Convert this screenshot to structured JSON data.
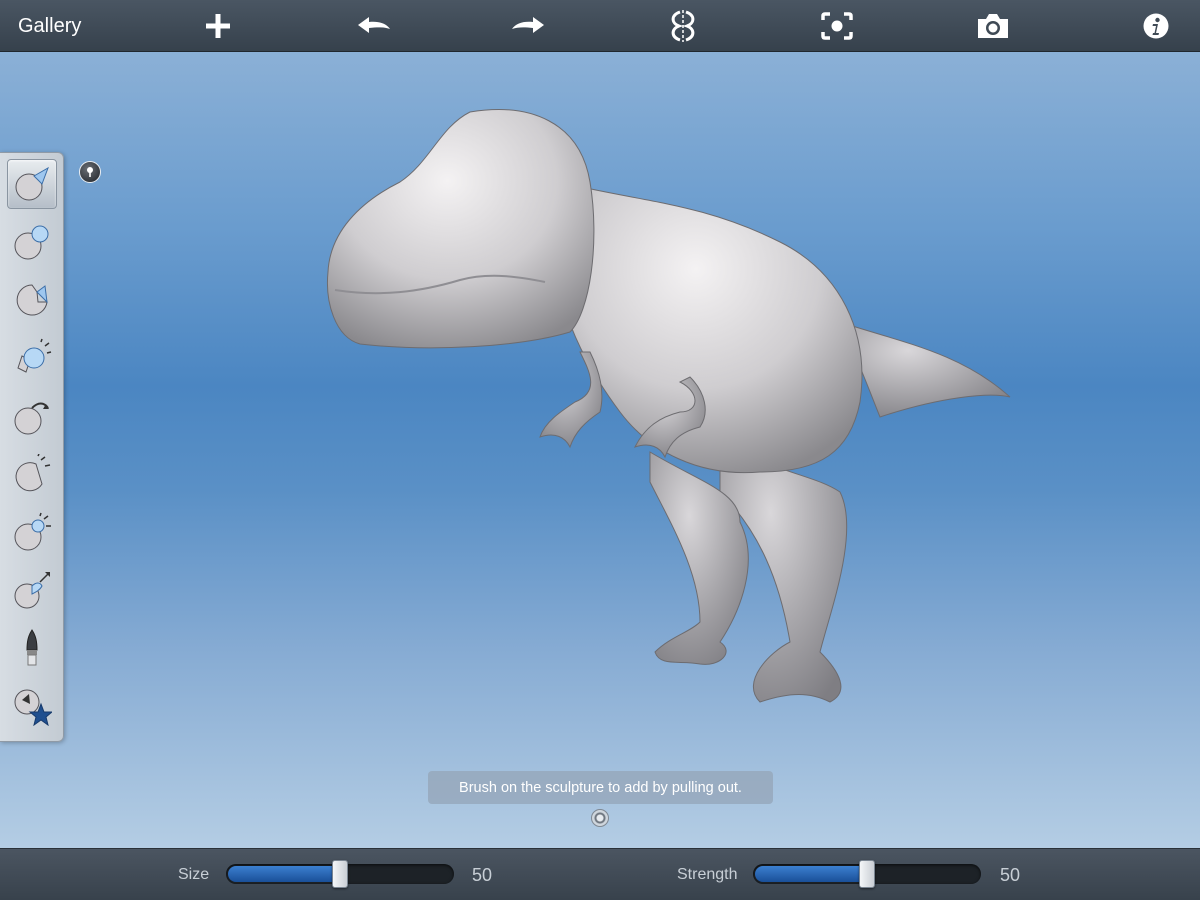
{
  "topbar": {
    "gallery_label": "Gallery",
    "icons": [
      "plus-icon",
      "undo-icon",
      "redo-icon",
      "symmetry-icon",
      "frame-icon",
      "camera-icon",
      "info-icon"
    ]
  },
  "tools": [
    {
      "name": "draw-tool",
      "active": true
    },
    {
      "name": "inflate-tool",
      "active": false
    },
    {
      "name": "pinch-tool",
      "active": false
    },
    {
      "name": "smooth-tool",
      "active": false
    },
    {
      "name": "grab-tool",
      "active": false
    },
    {
      "name": "flatten-tool",
      "active": false
    },
    {
      "name": "crease-tool",
      "active": false
    },
    {
      "name": "move-tool",
      "active": false
    },
    {
      "name": "paint-tool",
      "active": false
    },
    {
      "name": "favorites-tool",
      "active": false
    }
  ],
  "hint": {
    "text": "Brush on the sculpture to add by pulling out."
  },
  "sliders": {
    "size": {
      "label": "Size",
      "value": 50,
      "value_text": "50"
    },
    "strength": {
      "label": "Strength",
      "value": 50,
      "value_text": "50"
    }
  },
  "colors": {
    "accent": "#2a66b8",
    "bar": "#3f4a55"
  }
}
